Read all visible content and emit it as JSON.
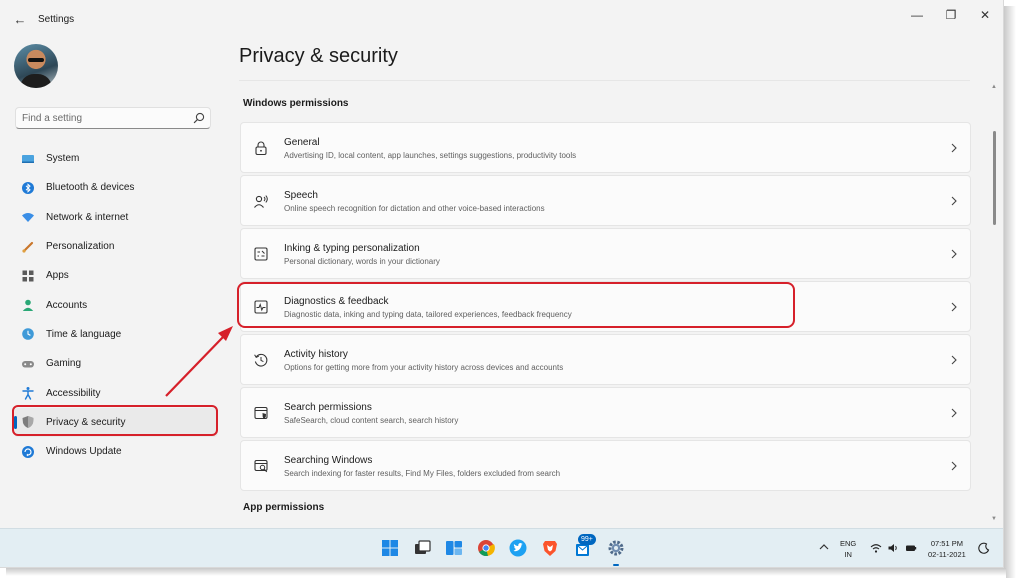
{
  "window": {
    "app_title": "Settings",
    "back_glyph": "←",
    "controls": [
      "—",
      "❐",
      "✕"
    ]
  },
  "sidebar": {
    "search_placeholder": "Find a setting",
    "items": [
      {
        "label": "System",
        "icon": "monitor-icon",
        "selected": false
      },
      {
        "label": "Bluetooth & devices",
        "icon": "bluetooth-icon",
        "selected": false
      },
      {
        "label": "Network & internet",
        "icon": "wifi-icon",
        "selected": false
      },
      {
        "label": "Personalization",
        "icon": "brush-icon",
        "selected": false
      },
      {
        "label": "Apps",
        "icon": "apps-icon",
        "selected": false
      },
      {
        "label": "Accounts",
        "icon": "person-icon",
        "selected": false
      },
      {
        "label": "Time & language",
        "icon": "globe-clock-icon",
        "selected": false
      },
      {
        "label": "Gaming",
        "icon": "gamepad-icon",
        "selected": false
      },
      {
        "label": "Accessibility",
        "icon": "accessibility-icon",
        "selected": false
      },
      {
        "label": "Privacy & security",
        "icon": "shield-icon",
        "selected": true
      },
      {
        "label": "Windows Update",
        "icon": "update-icon",
        "selected": false
      }
    ]
  },
  "main": {
    "page_title": "Privacy & security",
    "windows_permissions_title": "Windows permissions",
    "app_permissions_title": "App permissions",
    "cards": [
      {
        "title": "General",
        "desc": "Advertising ID, local content, app launches, settings suggestions, productivity tools",
        "icon": "lock-icon"
      },
      {
        "title": "Speech",
        "desc": "Online speech recognition for dictation and other voice-based interactions",
        "icon": "speech-icon"
      },
      {
        "title": "Inking & typing personalization",
        "desc": "Personal dictionary, words in your dictionary",
        "icon": "inking-icon"
      },
      {
        "title": "Diagnostics & feedback",
        "desc": "Diagnostic data, inking and typing data, tailored experiences, feedback frequency",
        "icon": "diagnostics-icon"
      },
      {
        "title": "Activity history",
        "desc": "Options for getting more from your activity history across devices and accounts",
        "icon": "history-icon"
      },
      {
        "title": "Search permissions",
        "desc": "SafeSearch, cloud content search, search history",
        "icon": "search-permissions-icon"
      },
      {
        "title": "Searching Windows",
        "desc": "Search indexing for faster results, Find My Files, folders excluded from search",
        "icon": "searching-windows-icon"
      }
    ]
  },
  "taskbar": {
    "badge": "99+",
    "lang_line1": "ENG",
    "lang_line2": "IN",
    "time": "07:51 PM",
    "date": "02-11-2021"
  },
  "colors": {
    "accent": "#0067c0",
    "annotation": "#d6202a",
    "background": "#f3f3f3",
    "card": "#fbfbfb"
  }
}
